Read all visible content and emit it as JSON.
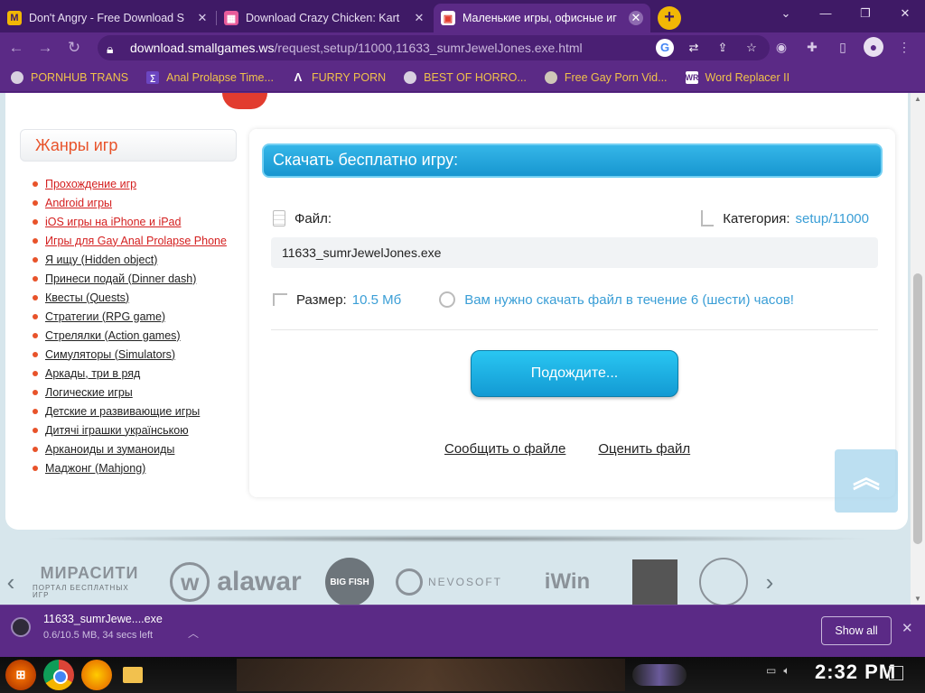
{
  "browser": {
    "tabs": [
      {
        "title": "Don't Angry - Free Download S",
        "favicon": "M",
        "favicon_color": "#f2b705",
        "active": false
      },
      {
        "title": "Download Crazy Chicken: Kart",
        "favicon": "▦",
        "favicon_color": "#e85b9a",
        "active": false
      },
      {
        "title": "Маленькие игры, офисные иг",
        "favicon": "▣",
        "favicon_color": "#e23c2f",
        "active": true
      }
    ],
    "new_tab": "+",
    "url_host": "download.smallgames.ws",
    "url_path": "/request,setup/11000,11633_sumrJewelJones.exe.html",
    "bookmarks": [
      {
        "label": "PORNHUB TRANS",
        "icon": "globe-icon"
      },
      {
        "label": "Anal Prolapse Time...",
        "icon": "bookmark-icon"
      },
      {
        "label": "FURRY PORN",
        "icon": "lambda-icon"
      },
      {
        "label": "BEST OF HORRO...",
        "icon": "globe-icon"
      },
      {
        "label": "Free Gay Porn Vid...",
        "icon": "animal-icon"
      },
      {
        "label": "Word Replacer II",
        "icon": "wr-icon"
      }
    ]
  },
  "sidebar": {
    "heading": "Жанры игр",
    "items": [
      {
        "label": "Прохождение игр",
        "hot": true
      },
      {
        "label": "Android игры",
        "hot": true
      },
      {
        "label": "iOS игры на iPhone и iPad",
        "hot": true
      },
      {
        "label": "Игры для Gay Anal Prolapse Phone",
        "hot": true
      },
      {
        "label": "Я ищу (Hidden object)",
        "hot": false
      },
      {
        "label": "Принеси подай (Dinner dash)",
        "hot": false
      },
      {
        "label": "Квесты (Quests)",
        "hot": false
      },
      {
        "label": "Стратегии (RPG game)",
        "hot": false
      },
      {
        "label": "Стрелялки (Action games)",
        "hot": false
      },
      {
        "label": "Симуляторы (Simulators)",
        "hot": false
      },
      {
        "label": "Аркады, три в ряд",
        "hot": false
      },
      {
        "label": "Логические игры",
        "hot": false
      },
      {
        "label": "Детские и развивающие игры",
        "hot": false
      },
      {
        "label": "Дитячі іграшки українською",
        "hot": false
      },
      {
        "label": "Арканоиды и зуманоиды",
        "hot": false
      },
      {
        "label": "Маджонг (Mahjong)",
        "hot": false
      }
    ]
  },
  "download": {
    "heading": "Скачать бесплатно игру:",
    "file_label": "Файл:",
    "category_label": "Категория:",
    "category_value": "setup/11000",
    "filename": "11633_sumrJewelJones.exe",
    "size_label": "Размер:",
    "size_value": "10.5 Мб",
    "notice": "Вам нужно скачать файл в течение 6 (шести) часов!",
    "wait_button": "Подождите...",
    "report_link": "Сообщить о файле",
    "rate_link": "Оценить файл"
  },
  "partners": {
    "logos": [
      {
        "name": "МИРАСИТИ",
        "sub": "ПОРТАЛ БЕСПЛАТНЫХ ИГР"
      },
      {
        "name": "alawar"
      },
      {
        "name": "BIG FISH"
      },
      {
        "name": "NEVOSOFT"
      },
      {
        "name": "iWin"
      },
      {
        "name": ""
      },
      {
        "name": ""
      }
    ]
  },
  "download_bar": {
    "filename": "11633_sumrJewe....exe",
    "progress": "0.6/10.5 MB, 34 secs left",
    "show_all": "Show all"
  },
  "taskbar": {
    "time": "2:32 PM"
  }
}
